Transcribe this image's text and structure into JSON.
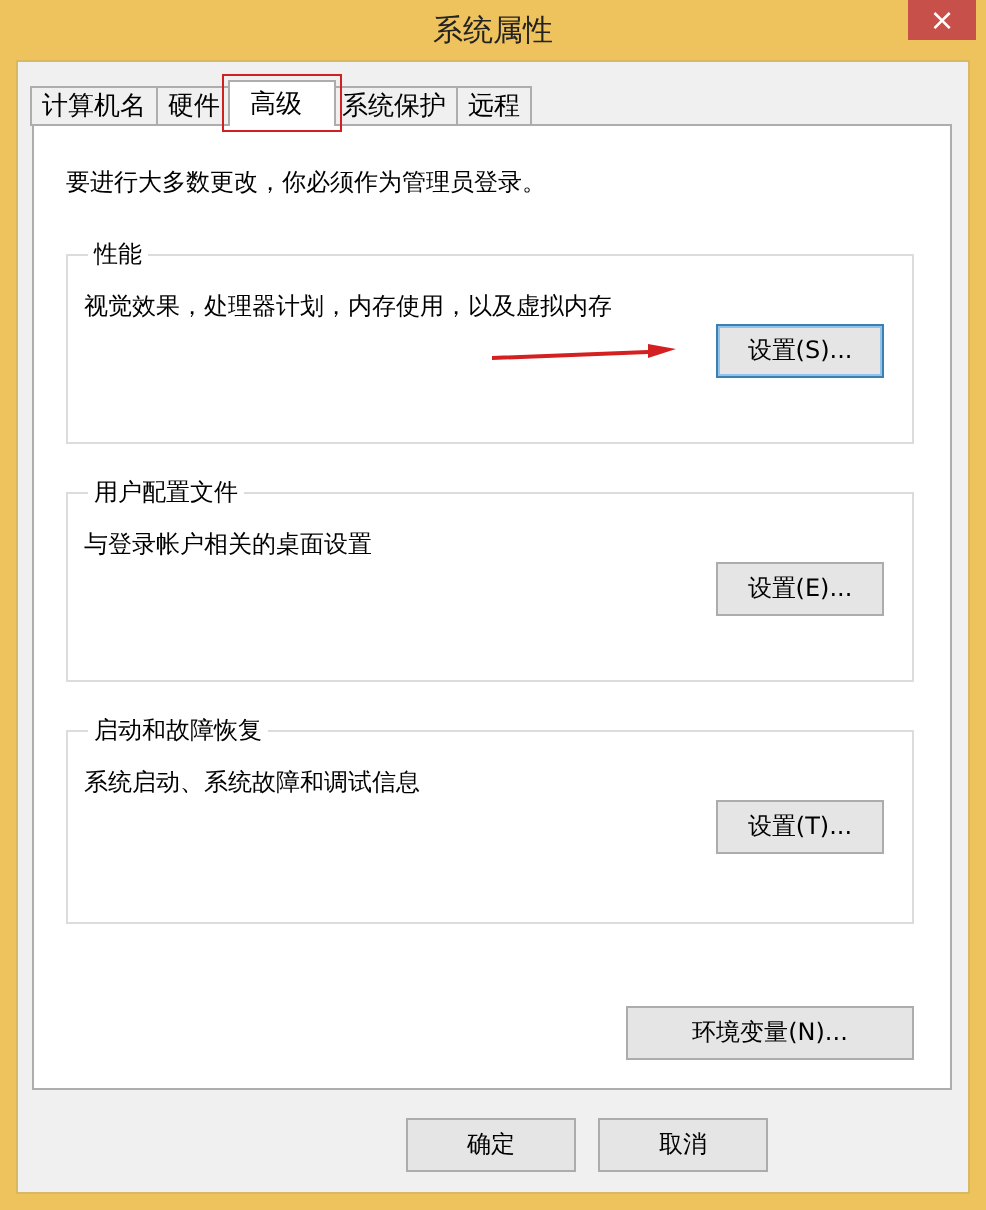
{
  "window": {
    "title": "系统属性",
    "close": "×"
  },
  "tabs": [
    {
      "label": "计算机名",
      "selected": false,
      "highlighted": false
    },
    {
      "label": "硬件",
      "selected": false,
      "highlighted": false
    },
    {
      "label": "高级",
      "selected": true,
      "highlighted": true
    },
    {
      "label": "系统保护",
      "selected": false,
      "highlighted": false
    },
    {
      "label": "远程",
      "selected": false,
      "highlighted": false
    }
  ],
  "notice": "要进行大多数更改，你必须作为管理员登录。",
  "groups": [
    {
      "title": "性能",
      "description": "视觉效果，处理器计划，内存使用，以及虚拟内存",
      "button": {
        "label": "设置(S)...",
        "focused": true
      },
      "pointed_at": true
    },
    {
      "title": "用户配置文件",
      "description": "与登录帐户相关的桌面设置",
      "button": {
        "label": "设置(E)...",
        "focused": false
      },
      "pointed_at": false
    },
    {
      "title": "启动和故障恢复",
      "description": "系统启动、系统故障和调试信息",
      "button": {
        "label": "设置(T)...",
        "focused": false
      },
      "pointed_at": false
    }
  ],
  "env_button": "环境变量(N)...",
  "dialog_buttons": [
    "确定",
    "取消"
  ]
}
